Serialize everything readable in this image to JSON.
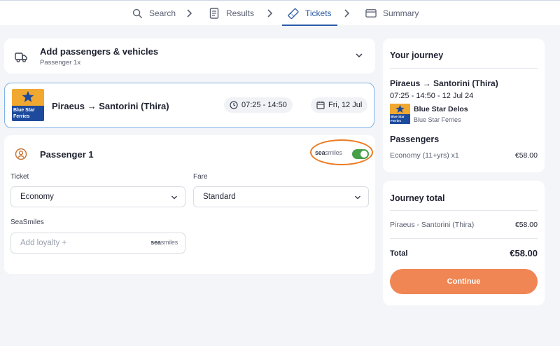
{
  "steps": {
    "search": "Search",
    "results": "Results",
    "tickets": "Tickets",
    "summary": "Summary"
  },
  "add_passengers": {
    "title": "Add passengers & vehicles",
    "subtitle": "Passenger 1x",
    "icon": "truck-icon"
  },
  "route_card": {
    "logo_text": "Blue Star Ferries",
    "route": "Piraeus → Santorini (Thira)",
    "time": "07:25 - 14:50",
    "date": "Fri, 12 Jul"
  },
  "passenger": {
    "title": "Passenger 1",
    "seasmiles_logo_bold": "sea",
    "seasmiles_logo_rest": "smiles",
    "toggle_on": true,
    "ticket_label": "Ticket",
    "ticket_value": "Economy",
    "fare_label": "Fare",
    "fare_value": "Standard",
    "seasmiles_label": "SeaSmiles",
    "loyalty_placeholder": "Add loyalty +"
  },
  "journey": {
    "title": "Your journey",
    "route": "Piraeus → Santorini (Thira)",
    "times": "07:25 - 14:50 - 12 Jul 24",
    "vessel": "Blue Star Delos",
    "operator": "Blue Star Ferries",
    "passengers_heading": "Passengers",
    "passenger_line": "Economy (11+yrs) x1",
    "passenger_price": "€58.00"
  },
  "total": {
    "title": "Journey total",
    "line_label": "Piraeus - Santorini (Thira)",
    "line_price": "€58.00",
    "total_label": "Total",
    "total_value": "€58.00",
    "continue_label": "Continue"
  },
  "colors": {
    "accent": "#2b5aa8",
    "continue": "#ef8654",
    "toggle": "#46a04a",
    "highlight": "#ee7a22"
  }
}
